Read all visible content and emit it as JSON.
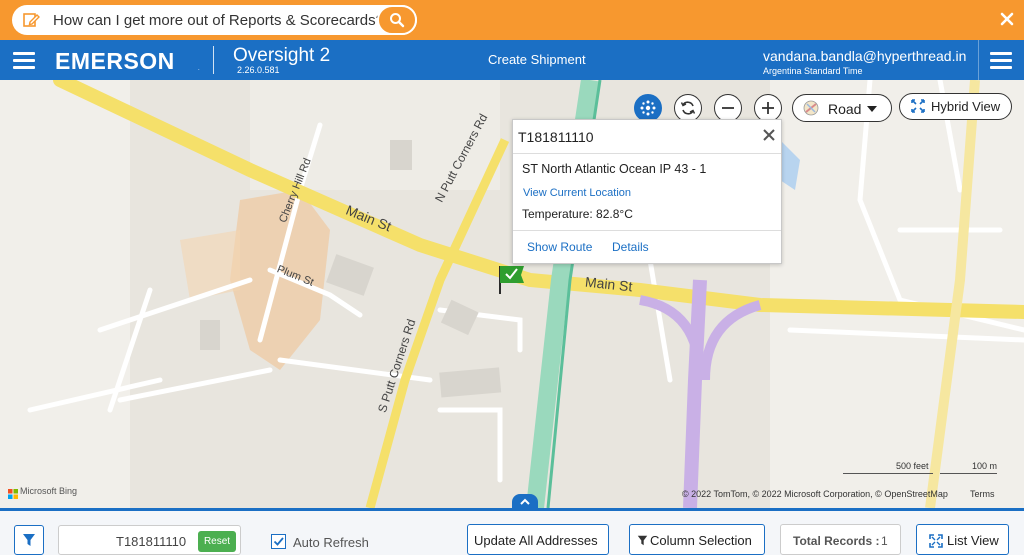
{
  "assistant_bar": {
    "prompt": "How can I get more out of Reports & Scorecards?",
    "edit_icon": "edit-icon",
    "search_icon": "search-icon",
    "close_icon": "close-icon",
    "bar_color": "#f7982f"
  },
  "header": {
    "brand": "EMERSON",
    "brand_mark": ".",
    "app_name": "Oversight 2",
    "app_version": "2.26.0.581",
    "center_link": "Create Shipment",
    "user_email": "vandana.bandla@hyperthread.in",
    "user_timezone": "Argentina Standard Time",
    "color": "#1b6fc4"
  },
  "map": {
    "controls": {
      "cluster_icon": "cluster-icon",
      "rotate_icon": "rotate-icon",
      "zoom_out_icon": "zoom-out-icon",
      "zoom_in_icon": "zoom-in-icon",
      "style_label": "Road",
      "hybrid_label": "Hybrid View"
    },
    "streets": {
      "main_st_1": "Main St",
      "main_st_2": "Main St",
      "n_putt": "N Putt Corners Rd",
      "s_putt": "S Putt Corners Rd",
      "cherry": "Cherry Hill Rd",
      "plum": "Plum St"
    },
    "popup": {
      "shipment_id": "T181811110",
      "location": "ST North Atlantic Ocean IP 43 - 1",
      "view_location": "View Current Location",
      "temperature": "Temperature: 82.8°C",
      "show_route": "Show Route",
      "details": "Details"
    },
    "attribution": "Microsoft Bing",
    "copyright": "© 2022 TomTom, © 2022 Microsoft Corporation, © OpenStreetMap",
    "terms": "Terms",
    "scale_feet": "500 feet",
    "scale_meters": "100 m"
  },
  "footer": {
    "search_value": "T181811110",
    "reset": "Reset",
    "auto_refresh": "Auto Refresh",
    "auto_refresh_checked": true,
    "update_all": "Update All Addresses",
    "column_selection": "Column Selection",
    "total_records_label": "Total Records :",
    "total_records_value": "1",
    "list_view": "List View"
  }
}
